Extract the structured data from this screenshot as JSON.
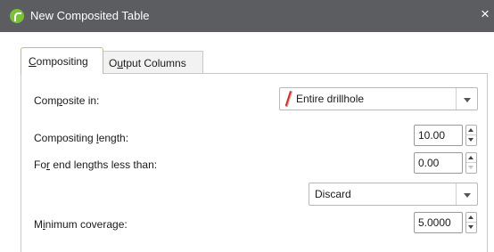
{
  "window": {
    "title": "New Composited Table",
    "close_glyph": "×",
    "app_icon": "leapfrog-logo-icon",
    "accent_color": "#7cbf3a",
    "titlebar_color": "#5b5d61"
  },
  "tabs": [
    {
      "label": "Compositing",
      "mnemonic": "C",
      "active": true
    },
    {
      "label": "Output Columns",
      "mnemonic": "u",
      "active": false
    }
  ],
  "form": {
    "composite_in": {
      "label": "Composite in:",
      "value": "Entire drillhole",
      "icon": "drillhole-swatch-icon"
    },
    "compositing_length": {
      "label": "Compositing length:",
      "value": "10.00"
    },
    "end_lengths": {
      "label": "For end lengths less than:",
      "value": "0.00"
    },
    "end_action": {
      "value": "Discard"
    },
    "minimum_coverage": {
      "label": "Minimum coverage:",
      "value": "5.0000"
    }
  },
  "colors": {
    "active_tab_border": "#f0b432",
    "swatch_stroke": "#c0392b"
  }
}
